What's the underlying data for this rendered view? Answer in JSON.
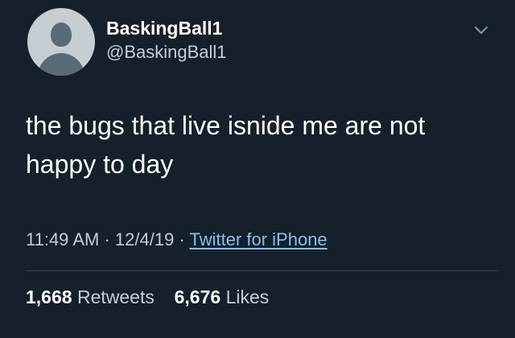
{
  "user": {
    "display_name": "BaskingBall1",
    "handle": "@BaskingBall1",
    "avatar_icon": "default-avatar-icon"
  },
  "menu_icon": "chevron-down-icon",
  "tweet": {
    "text": "the bugs that live isnide me are not happy to day"
  },
  "meta": {
    "time": "11:49 AM",
    "sep1": "·",
    "date": "12/4/19",
    "sep2": "·",
    "source": "Twitter for iPhone"
  },
  "stats": {
    "retweets_count": "1,668",
    "retweets_label": "Retweets",
    "likes_count": "6,676",
    "likes_label": "Likes"
  },
  "colors": {
    "background": "#15202b",
    "link": "#8bbfe9",
    "secondary_text": "#c4cdd4"
  }
}
